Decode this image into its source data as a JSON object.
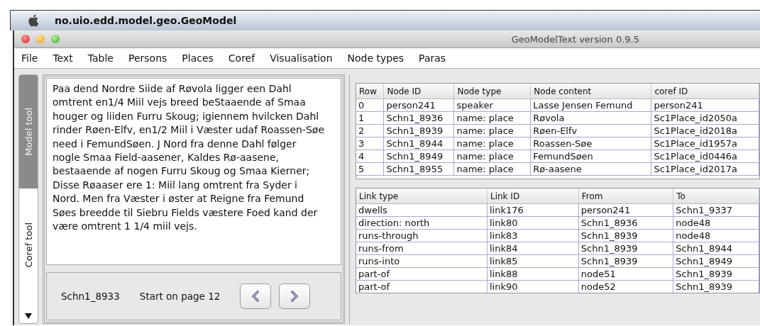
{
  "app_menu_title": "no.uio.edd.model.geo.GeoModel",
  "window": {
    "title": "GeoModelText version 0.9.5"
  },
  "menu": [
    "File",
    "Text",
    "Table",
    "Persons",
    "Places",
    "Coref",
    "Visualisation",
    "Node types",
    "Paras"
  ],
  "side_tabs": [
    {
      "label": "Model tool",
      "selected": true
    },
    {
      "label": "Coref tool",
      "selected": false
    }
  ],
  "text": "Paa dend Nordre Siide af Røvola ligger een Dahl omtrent en1/4 Miil vejs breed beStaaende af Smaa houger og liiden Furru Skoug; igiennem hvilcken Dahl rinder Røen-Elfv, en1/2 Miil i Væster udaf Roassen-Søe need i FemundSøen. J Nord fra denne Dahl følger nogle Smaa Field-aasener, Kaldes Rø-aasene, bestaaende af nogen Furru Skoug og Smaa Kierner; Disse Røaaser ere 1: Miil lang omtrent fra Syder i Nord. Men fra Væster i øster at Reigne fra Femund Søes breedde til Siebru Fields væstere Foed kand der være omtrent 1 1/4 miil vejs.",
  "footer": {
    "node_id": "Schn1_8933",
    "page": "Start on page 12"
  },
  "node_table": {
    "columns": [
      "Row",
      "Node ID",
      "Node type",
      "Node content",
      "coref ID"
    ],
    "rows": [
      [
        "0",
        "person241",
        "speaker",
        "Lasse Jensen Femund",
        "person241"
      ],
      [
        "1",
        "Schn1_8936",
        "name: place",
        "Røvola",
        "Sc1Place_id2050a"
      ],
      [
        "2",
        "Schn1_8939",
        "name: place",
        "Røen-Elfv",
        "Sc1Place_id2018a"
      ],
      [
        "3",
        "Schn1_8944",
        "name: place",
        "Roassen-Søe",
        "Sc1Place_id1957a"
      ],
      [
        "4",
        "Schn1_8949",
        "name: place",
        "FemundSøen",
        "Sc1Place_id0446a"
      ],
      [
        "5",
        "Schn1_8955",
        "name: place",
        "Rø-aasene",
        "Sc1Place_id2017a"
      ]
    ]
  },
  "link_table": {
    "columns": [
      "Link type",
      "Link ID",
      "From",
      "To"
    ],
    "rows": [
      [
        "dwells",
        "link176",
        "person241",
        "Schn1_9337"
      ],
      [
        "direction: north",
        "link80",
        "Schn1_8936",
        "node48"
      ],
      [
        "runs-through",
        "link83",
        "Schn1_8939",
        "node48"
      ],
      [
        "runs-from",
        "link84",
        "Schn1_8939",
        "Schn1_8944"
      ],
      [
        "runs-into",
        "link85",
        "Schn1_8939",
        "Schn1_8949"
      ],
      [
        "part-of",
        "link88",
        "node51",
        "Schn1_8939"
      ],
      [
        "part-of",
        "link90",
        "node52",
        "Schn1_8939"
      ]
    ]
  }
}
